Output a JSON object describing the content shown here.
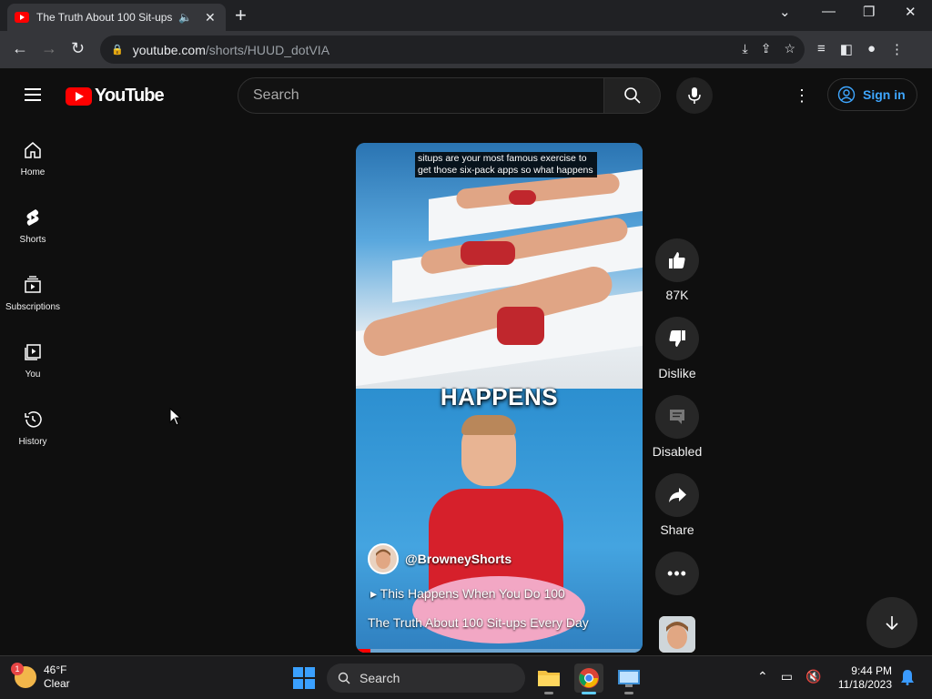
{
  "browser": {
    "tab_title": "The Truth About 100 Sit-ups",
    "tab_audio_icon": "speaker-icon",
    "url_host": "youtube.com",
    "url_path": "/shorts/HUUD_dotVIA"
  },
  "header": {
    "logo_text": "YouTube",
    "search_placeholder": "Search",
    "signin_label": "Sign in"
  },
  "sidebar": {
    "items": [
      {
        "label": "Home",
        "icon": "home-icon"
      },
      {
        "label": "Shorts",
        "icon": "shorts-icon"
      },
      {
        "label": "Subscriptions",
        "icon": "subscriptions-icon"
      },
      {
        "label": "You",
        "icon": "library-icon"
      },
      {
        "label": "History",
        "icon": "history-icon"
      }
    ]
  },
  "video": {
    "caption": "situps are your most famous exercise to get those six-pack apps so what happens",
    "overlay_word": "HAPPENS",
    "channel": "@BrowneyShorts",
    "related": "This Happens When You Do 100",
    "title": "The Truth About 100 Sit-ups Every Day",
    "progress": 0.05
  },
  "actions": {
    "likes": "87K",
    "dislike": "Dislike",
    "comments": "Disabled",
    "share": "Share"
  },
  "taskbar": {
    "temp": "46°F",
    "condition": "Clear",
    "weather_badge": "1",
    "search_label": "Search",
    "time": "9:44 PM",
    "date": "11/18/2023"
  },
  "colors": {
    "brand_red": "#ff0000",
    "link_blue": "#3ea6ff",
    "bg": "#0f0f0f"
  }
}
